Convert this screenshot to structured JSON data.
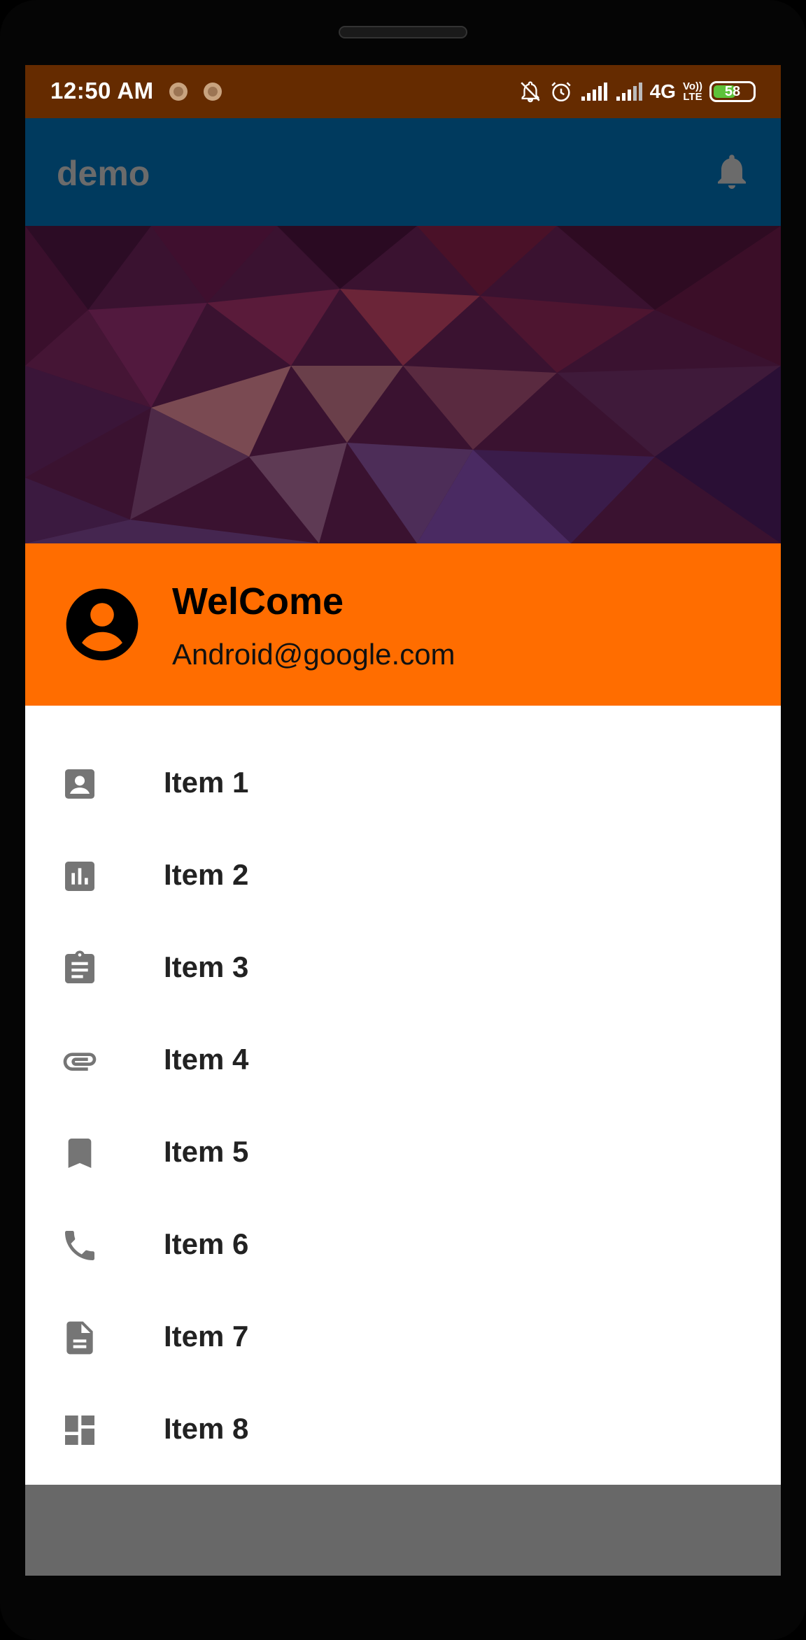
{
  "status_bar": {
    "time": "12:50 AM",
    "network": "4G",
    "volte": [
      "Vo))",
      "LTE"
    ],
    "battery": "58",
    "battery_level": 0.58,
    "icons": [
      "notification-dot-icon",
      "notification-dot-icon",
      "bell-off-icon",
      "alarm-icon",
      "signal-icon",
      "signal-icon",
      "battery-icon"
    ]
  },
  "appbar": {
    "title": "demo",
    "action_icon": "bell-icon"
  },
  "drawer_header": {
    "name": "WelCome",
    "email": "Android@google.com",
    "avatar_icon": "account-circle-icon"
  },
  "menu": {
    "items": [
      {
        "label": "Item 1",
        "icon": "account-box-icon"
      },
      {
        "label": "Item 2",
        "icon": "bar-chart-icon"
      },
      {
        "label": "Item 3",
        "icon": "clipboard-icon"
      },
      {
        "label": "Item 4",
        "icon": "attachment-icon"
      },
      {
        "label": "Item 5",
        "icon": "bookmark-icon"
      },
      {
        "label": "Item 6",
        "icon": "phone-icon"
      },
      {
        "label": "Item 7",
        "icon": "document-icon"
      },
      {
        "label": "Item 8",
        "icon": "dashboard-icon"
      }
    ]
  },
  "colors": {
    "status_bar": "#652b00",
    "appbar": "#003a5e",
    "header": "#ff6d00",
    "icon": "#757575",
    "scrim": "#686868"
  }
}
